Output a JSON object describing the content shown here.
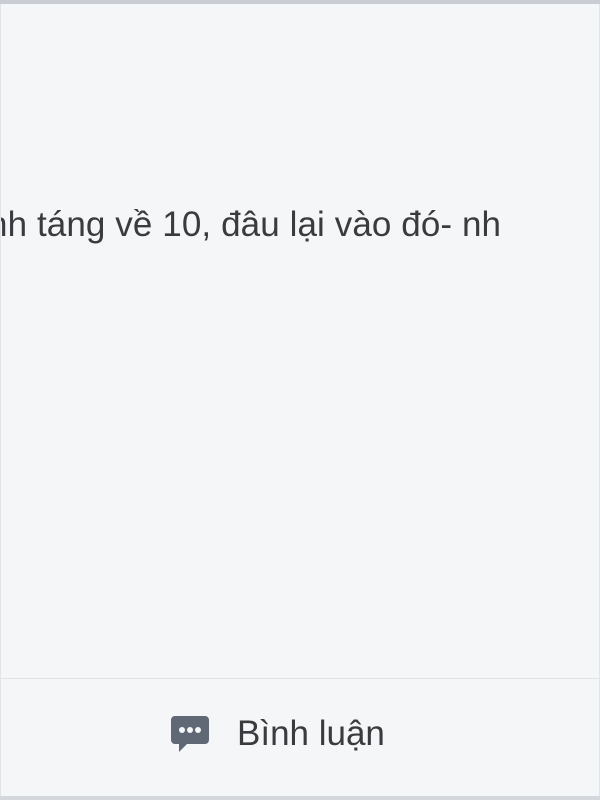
{
  "post": {
    "text": "nh táng về 10, đâu lại vào đó- nh"
  },
  "actions": {
    "comment_label": "Bình luận",
    "comment_icon": "comment-icon"
  },
  "colors": {
    "card_background": "#f5f6f8",
    "text": "#3a3b3e",
    "icon": "#5f6874"
  }
}
